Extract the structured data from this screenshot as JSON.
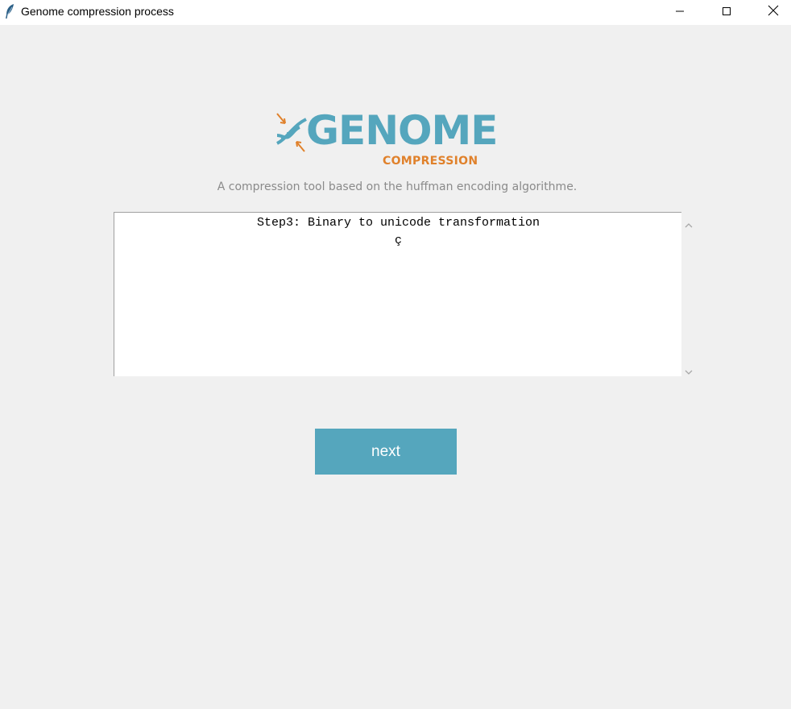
{
  "window": {
    "title": "Genome compression process",
    "icons": {
      "app": "feather-icon",
      "minimize": "minimize-icon",
      "maximize": "maximize-icon",
      "close": "close-icon"
    }
  },
  "logo": {
    "word": "GENOME",
    "subword": "COMPRESSION",
    "icon": "dna-icon",
    "colors": {
      "primary": "#55a6bd",
      "accent": "#e0812b"
    }
  },
  "tagline": "A compression tool based on the huffman encoding algorithme.",
  "output": {
    "lines": [
      "Step3: Binary to unicode transformation",
      "ç"
    ]
  },
  "scrollbar": {
    "up_icon": "chevron-up-icon",
    "down_icon": "chevron-down-icon"
  },
  "actions": {
    "next_label": "next",
    "button_color": "#55a6bd"
  }
}
